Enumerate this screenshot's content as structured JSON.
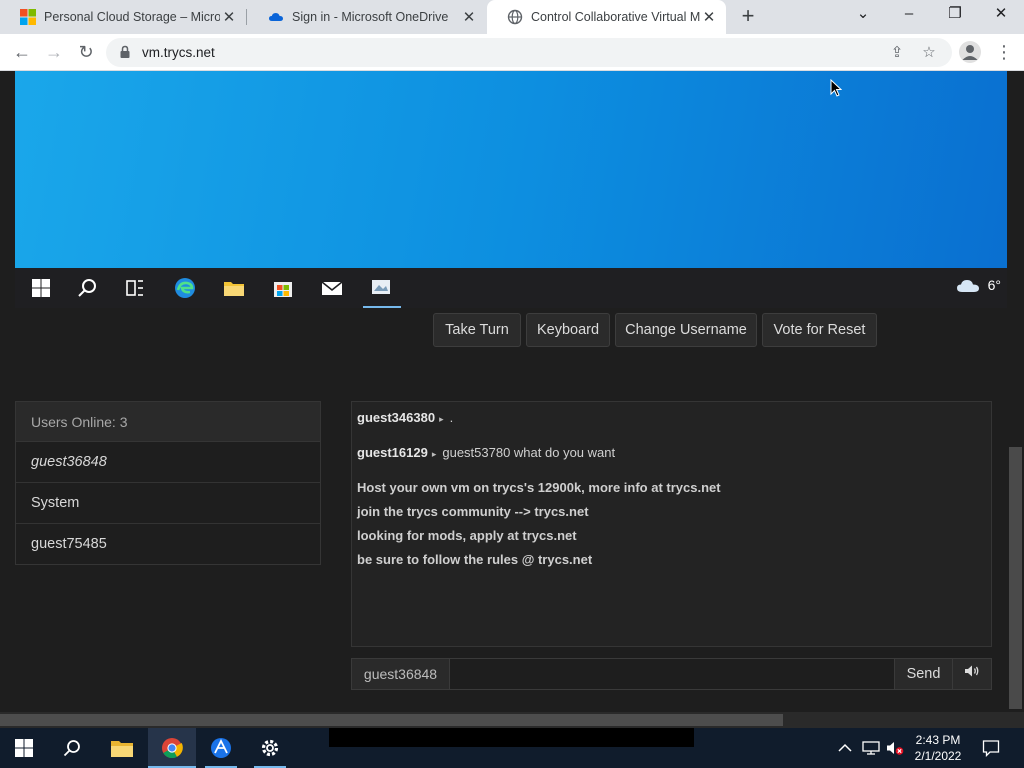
{
  "browser": {
    "tabs": [
      {
        "title": "Personal Cloud Storage – Microsoft",
        "active": false
      },
      {
        "title": "Sign in - Microsoft OneDrive",
        "active": false
      },
      {
        "title": "Control Collaborative Virtual Machine",
        "active": true
      }
    ],
    "url": "vm.trycs.net"
  },
  "vm": {
    "weather_temp": "6°"
  },
  "controls": {
    "take_turn": "Take Turn",
    "keyboard": "Keyboard",
    "change_username": "Change Username",
    "vote_reset": "Vote for Reset"
  },
  "users": {
    "header": "Users Online: 3",
    "list": [
      "guest36848",
      "System",
      "guest75485"
    ]
  },
  "chat": {
    "messages": [
      {
        "user": "guest346380",
        "text": "."
      },
      {
        "user": "guest16129",
        "text": "guest53780 what do you want"
      }
    ],
    "system": [
      "Host your own vm on trycs's 12900k, more info at trycs.net",
      "join the trycs community --> trycs.net",
      "looking for mods, apply at trycs.net",
      "be sure to follow the rules @ trycs.net"
    ],
    "username": "guest36848",
    "input_value": "",
    "send_label": "Send"
  },
  "taskbar": {
    "time": "2:43 PM",
    "date": "2/1/2022"
  },
  "colors": {
    "accent": "#76b9ed",
    "vm_desktop": "#0d8fe0",
    "page_bg": "#1e1e1e"
  }
}
